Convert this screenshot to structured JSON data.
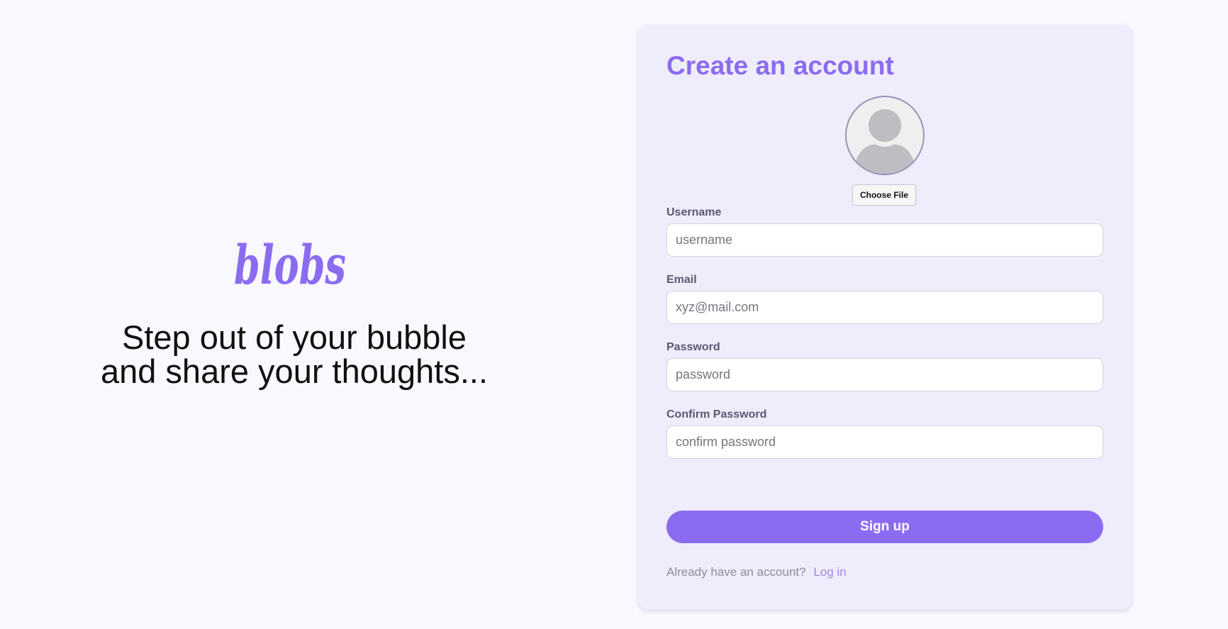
{
  "brand": {
    "name": "blobs",
    "tagline_line1": "Step out of your bubble",
    "tagline_line2": "and share your thoughts..."
  },
  "signup": {
    "title": "Create an account",
    "choose_file_label": "Choose File",
    "fields": {
      "username": {
        "label": "Username",
        "placeholder": "username"
      },
      "email": {
        "label": "Email",
        "placeholder": "xyz@mail.com"
      },
      "password": {
        "label": "Password",
        "placeholder": "password"
      },
      "confirm_password": {
        "label": "Confirm Password",
        "placeholder": "confirm password"
      }
    },
    "submit_label": "Sign up",
    "login_prompt": "Already have an account?",
    "login_link": "Log in"
  },
  "colors": {
    "accent": "#8b6cf0",
    "card_background": "#efedfc",
    "page_background": "#f9f8fe"
  }
}
